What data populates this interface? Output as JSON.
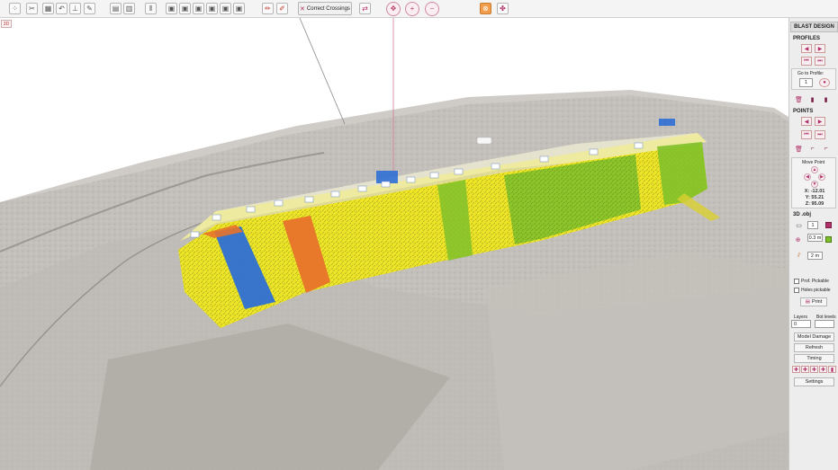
{
  "toolbar": {
    "correct_crossings_label": "Correct Crossings",
    "icons": [
      "points-icon",
      "split-line-icon",
      "grid-icon",
      "undo-edit-icon",
      "measure-icon",
      "pen-icon",
      "table-icon",
      "book-icon",
      "column-icon",
      "blocks-icon",
      "blocks2-icon",
      "blocks3-icon",
      "blocks4-icon",
      "blocks5-icon",
      "pencil-icon",
      "pencil-delete-icon",
      "crossings-icon",
      "swap-icon",
      "move-icon",
      "zoom-in-icon",
      "zoom-out-icon",
      "stop-icon",
      "pin-icon"
    ]
  },
  "view": {
    "corner_badge": "3D",
    "hole_labels": [
      "1",
      "2",
      "3",
      "4",
      "5",
      "6",
      "7",
      "8",
      "9",
      "10",
      "11",
      "12",
      "13",
      "14",
      "15"
    ],
    "colors": {
      "yellow": "#f1e71b",
      "blue": "#2f6fd4",
      "orange": "#e8732a",
      "green": "#7fc12a",
      "terrain": "#c9c6c1"
    }
  },
  "panel": {
    "title": "BLAST DESIGN",
    "profiles_label": "PROFILES",
    "go_to_profile_label": "Go to Profile:",
    "go_to_profile_value": "1",
    "points_label": "POINTS",
    "move_point_label": "Move Point",
    "x": "X: -12.01",
    "y": "Y: 55.21",
    "z": "Z: 95.09",
    "obj_label": "3D .obj",
    "obj_value": "1",
    "step_value": "0.3 m",
    "count_value": "2 m",
    "prof_pickable_label": "Prof. Pickable",
    "holes_pickable_label": "Holes pickable",
    "print_label": "Print",
    "layers_label": "Layers",
    "bot_levels_label": "Bot levels",
    "layers_value": "0",
    "model_damage_label": "Model Damage",
    "refresh_label": "Refresh",
    "timing_label": "Timing",
    "settings_label": "Settings"
  }
}
